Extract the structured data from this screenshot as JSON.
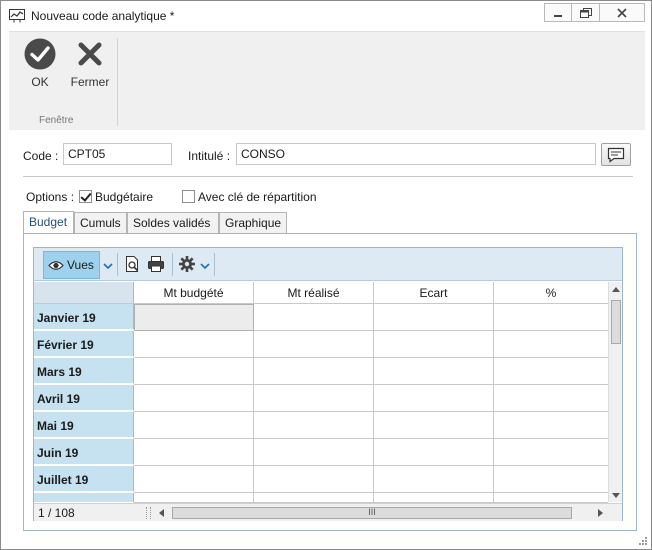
{
  "window": {
    "title": "Nouveau code analytique *"
  },
  "ribbon": {
    "ok_label": "OK",
    "close_label": "Fermer",
    "group_label": "Fenêtre"
  },
  "form": {
    "code_label": "Code :",
    "code_value": "CPT05",
    "intitule_label": "Intitulé :",
    "intitule_value": "CONSO",
    "options_label": "Options :",
    "budgetaire_label": "Budgétaire",
    "budgetaire_checked": true,
    "cle_label": "Avec clé de répartition",
    "cle_checked": false
  },
  "tabs": [
    "Budget",
    "Cumuls",
    "Soldes validés",
    "Graphique"
  ],
  "active_tab": "Budget",
  "grid": {
    "toolbar": {
      "views_label": "Vues"
    },
    "columns": [
      "Mt budgété",
      "Mt réalisé",
      "Ecart",
      "%"
    ],
    "rows": [
      "Janvier 19",
      "Février 19",
      "Mars 19",
      "Avril 19",
      "Mai 19",
      "Juin 19",
      "Juillet 19"
    ],
    "row_counter": "1 / 108",
    "hscroll_grip": "III"
  },
  "colors": {
    "row_header_bg": "#c6e1ef",
    "toolbar_bg": "#dde9f3",
    "views_button_bg": "#9ed2ec",
    "tab_border": "#9cb7d0"
  }
}
